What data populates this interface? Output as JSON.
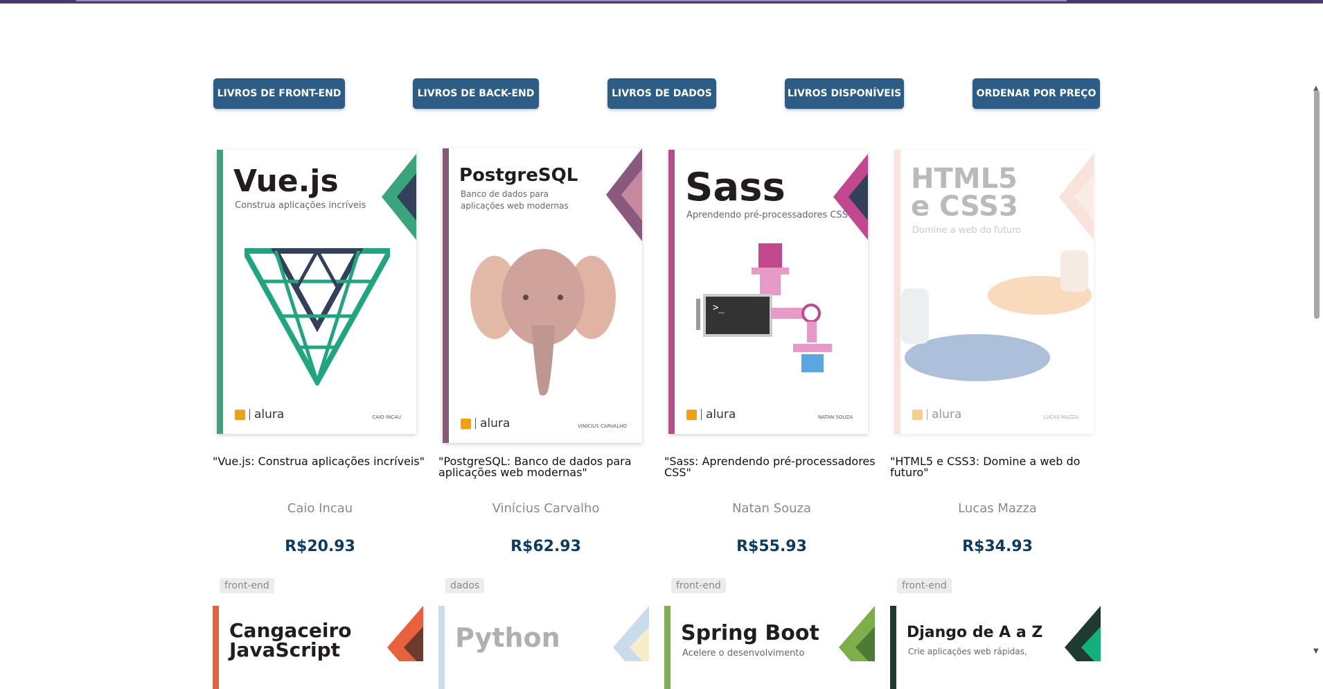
{
  "filters": [
    {
      "label": "LIVROS DE FRONT-END"
    },
    {
      "label": "LIVROS DE BACK-END"
    },
    {
      "label": "LIVROS DE DADOS"
    },
    {
      "label": "LIVROS DISPONÍVEIS"
    },
    {
      "label": "ORDENAR POR PREÇO"
    }
  ],
  "books": [
    {
      "cover_title": "Vue.js",
      "cover_subtitle": "Construa aplicações incríveis",
      "cover_publisher": "alura",
      "cover_author": "CAIO INCAU",
      "title": "\"Vue.js: Construa aplicações incríveis\"",
      "author": "Caio Incau",
      "price": "R$20.93",
      "accent": "#3aa57c"
    },
    {
      "cover_title": "PostgreSQL",
      "cover_subtitle": "Banco de dados para aplicações web modernas",
      "cover_publisher": "alura",
      "cover_author": "VINÍCIUS CARVALHO",
      "title": "\"PostgreSQL: Banco de dados para aplicações web modernas\"",
      "author": "Vinícius Carvalho",
      "price": "R$62.93",
      "accent": "#8a5a7e"
    },
    {
      "cover_title": "Sass",
      "cover_subtitle": "Aprendendo pré-processadores CSS",
      "cover_publisher": "alura",
      "cover_author": "NATAN SOUZA",
      "title": "\"Sass: Aprendendo pré-processadores CSS\"",
      "author": "Natan Souza",
      "price": "R$55.93",
      "accent": "#b84c8f"
    },
    {
      "cover_title": "HTML5 e CSS3",
      "cover_subtitle": "Domine a web do futuro",
      "cover_publisher": "alura",
      "cover_author": "LUCAS MAZZA",
      "title": "\"HTML5 e CSS3: Domine a web do futuro\"",
      "author": "Lucas Mazza",
      "price": "R$34.93",
      "accent": "#f3c7b5"
    }
  ],
  "next_row": [
    {
      "tag": "front-end",
      "cover_title": "Cangaceiro JavaScript",
      "accent": "#e8603c"
    },
    {
      "tag": "dados",
      "cover_title": "Python",
      "accent": "#c8dcec"
    },
    {
      "tag": "front-end",
      "cover_title": "Spring Boot",
      "cover_subtitle": "Acelere o desenvolvimento",
      "accent": "#7cae4a"
    },
    {
      "tag": "front-end",
      "cover_title": "Django de A a Z",
      "cover_subtitle": "Crie aplicações web rápidas,",
      "accent": "#1f3a30"
    }
  ]
}
